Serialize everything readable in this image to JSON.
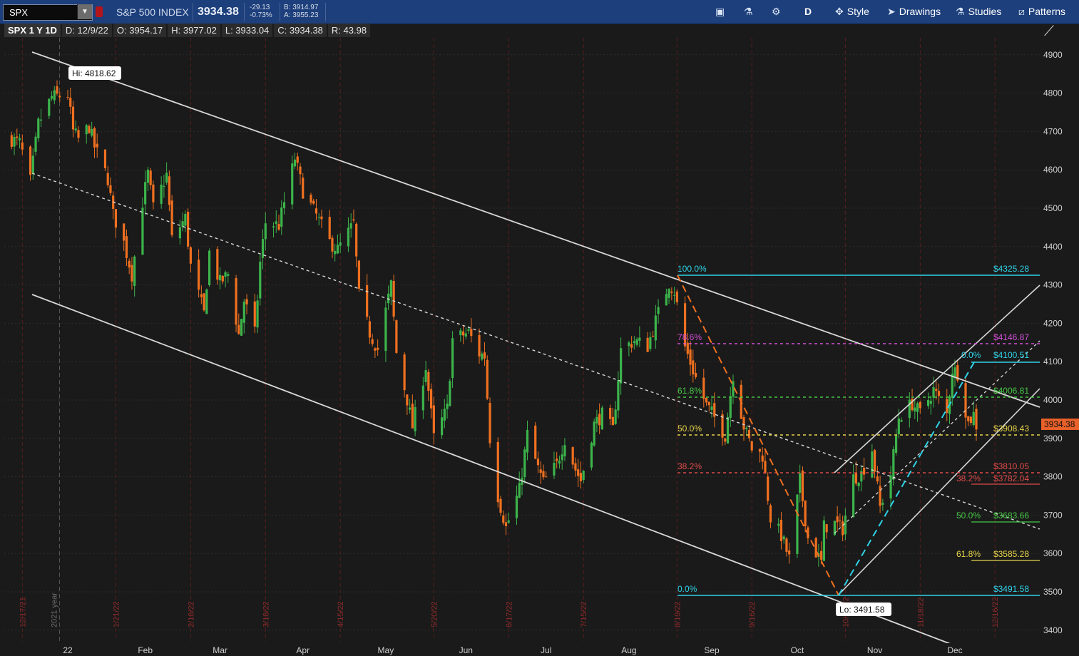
{
  "header": {
    "symbol": "SPX",
    "index_name": "S&P 500 INDEX",
    "last": "3934.38",
    "net_change": "-29.13",
    "pct_change": "-0.73%",
    "bid": "B: 3914.97",
    "ask": "A: 3955.23",
    "toolbar": {
      "aggregation": "D",
      "style": "Style",
      "drawings": "Drawings",
      "studies": "Studies",
      "patterns": "Patterns"
    }
  },
  "info": {
    "symbol": "SPX 1 Y 1D",
    "date": "D: 12/9/22",
    "open": "O: 3954.17",
    "high": "H: 3977.02",
    "low": "L: 3933.04",
    "close": "C: 3934.38",
    "range": "R: 43.98"
  },
  "colors": {
    "up": "#3cb44b",
    "down": "#f07020",
    "background": "#1a1a1a",
    "topbar": "#1d3f7c",
    "price_tag": "#e8602a",
    "fib_cyan": "#2fd3e8",
    "fib_magenta": "#d24fd8",
    "fib_green": "#46c846",
    "fib_yellow": "#e8d44a",
    "fib_red": "#e04a4a",
    "channel": "#d8d8d8"
  },
  "chart_data": {
    "type": "candlestick",
    "symbol": "SPX",
    "period": "1 Y",
    "interval": "1D",
    "ylim": [
      3370,
      4960
    ],
    "yticks": [
      3400,
      3500,
      3600,
      3700,
      3800,
      3900,
      4000,
      4100,
      4200,
      4300,
      4400,
      4500,
      4600,
      4700,
      4800,
      4900
    ],
    "month_labels": [
      {
        "label": "22",
        "date": "2022-01-03"
      },
      {
        "label": "Feb",
        "date": "2022-02-01"
      },
      {
        "label": "Mar",
        "date": "2022-03-01"
      },
      {
        "label": "Apr",
        "date": "2022-04-01"
      },
      {
        "label": "May",
        "date": "2022-05-02"
      },
      {
        "label": "Jun",
        "date": "2022-06-01"
      },
      {
        "label": "Jul",
        "date": "2022-07-01"
      },
      {
        "label": "Aug",
        "date": "2022-08-01"
      },
      {
        "label": "Sep",
        "date": "2022-09-01"
      },
      {
        "label": "Oct",
        "date": "2022-10-03"
      },
      {
        "label": "Nov",
        "date": "2022-11-01"
      },
      {
        "label": "Dec",
        "date": "2022-12-01"
      }
    ],
    "expiration_markers": [
      "12/17/21",
      "1/21/22",
      "2/18/22",
      "3/18/22",
      "4/15/22",
      "5/20/22",
      "6/17/22",
      "7/15/22",
      "8/19/22",
      "9/16/22",
      "10/21/22",
      "11/18/22",
      "12/16/22"
    ],
    "year_marker": "2021 year",
    "last_price": 3934.38,
    "high_annotation": {
      "label": "Hi: 4818.62",
      "value": 4818.62
    },
    "low_annotation": {
      "label": "Lo: 3491.58",
      "value": 3491.58
    },
    "fib_retracement_1": [
      {
        "pct": "100.0%",
        "value": "$4325.28"
      },
      {
        "pct": "78.6%",
        "value": "$4146.87"
      },
      {
        "pct": "61.8%",
        "value": "$4006.81"
      },
      {
        "pct": "50.0%",
        "value": "$3908.43"
      },
      {
        "pct": "38.2%",
        "value": "$3810.05"
      },
      {
        "pct": "0.0%",
        "value": "$3491.58"
      }
    ],
    "fib_retracement_2": [
      {
        "pct": "0.0%",
        "value": "$4100.51"
      },
      {
        "pct": "38.2%",
        "value": "$3782.04"
      },
      {
        "pct": "50.0%",
        "value": "$3683.66"
      },
      {
        "pct": "61.8%",
        "value": "$3585.28"
      }
    ],
    "close_path": [
      [
        "2021-12-13",
        4680
      ],
      [
        "2021-12-16",
        4670
      ],
      [
        "2021-12-20",
        4570
      ],
      [
        "2021-12-23",
        4720
      ],
      [
        "2021-12-28",
        4790
      ],
      [
        "2022-01-03",
        4796
      ],
      [
        "2022-01-05",
        4700
      ],
      [
        "2022-01-07",
        4680
      ],
      [
        "2022-01-11",
        4713
      ],
      [
        "2022-01-13",
        4660
      ],
      [
        "2022-01-18",
        4577
      ],
      [
        "2022-01-20",
        4483
      ],
      [
        "2022-01-24",
        4410
      ],
      [
        "2022-01-27",
        4327
      ],
      [
        "2022-01-31",
        4516
      ],
      [
        "2022-02-02",
        4590
      ],
      [
        "2022-02-04",
        4500
      ],
      [
        "2022-02-09",
        4587
      ],
      [
        "2022-02-11",
        4419
      ],
      [
        "2022-02-16",
        4475
      ],
      [
        "2022-02-18",
        4349
      ],
      [
        "2022-02-23",
        4225
      ],
      [
        "2022-02-25",
        4385
      ],
      [
        "2022-03-01",
        4306
      ],
      [
        "2022-03-04",
        4328
      ],
      [
        "2022-03-08",
        4170
      ],
      [
        "2022-03-10",
        4260
      ],
      [
        "2022-03-14",
        4173
      ],
      [
        "2022-03-16",
        4358
      ],
      [
        "2022-03-18",
        4463
      ],
      [
        "2022-03-23",
        4456
      ],
      [
        "2022-03-29",
        4631
      ],
      [
        "2022-04-01",
        4545
      ],
      [
        "2022-04-06",
        4481
      ],
      [
        "2022-04-11",
        4412
      ],
      [
        "2022-04-14",
        4392
      ],
      [
        "2022-04-20",
        4459
      ],
      [
        "2022-04-22",
        4272
      ],
      [
        "2022-04-26",
        4175
      ],
      [
        "2022-04-29",
        4132
      ],
      [
        "2022-05-04",
        4300
      ],
      [
        "2022-05-06",
        4123
      ],
      [
        "2022-05-10",
        4001
      ],
      [
        "2022-05-12",
        3930
      ],
      [
        "2022-05-17",
        4088
      ],
      [
        "2022-05-20",
        3901
      ],
      [
        "2022-05-25",
        3978
      ],
      [
        "2022-05-27",
        4158
      ],
      [
        "2022-06-02",
        4176
      ],
      [
        "2022-06-06",
        4121
      ],
      [
        "2022-06-08",
        4115
      ],
      [
        "2022-06-10",
        3901
      ],
      [
        "2022-06-13",
        3750
      ],
      [
        "2022-06-16",
        3667
      ],
      [
        "2022-06-21",
        3765
      ],
      [
        "2022-06-24",
        3911
      ],
      [
        "2022-06-28",
        3821
      ],
      [
        "2022-06-30",
        3785
      ],
      [
        "2022-07-05",
        3831
      ],
      [
        "2022-07-08",
        3899
      ],
      [
        "2022-07-12",
        3819
      ],
      [
        "2022-07-14",
        3790
      ],
      [
        "2022-07-19",
        3937
      ],
      [
        "2022-07-22",
        3962
      ],
      [
        "2022-07-26",
        3921
      ],
      [
        "2022-07-29",
        4130
      ],
      [
        "2022-08-03",
        4155
      ],
      [
        "2022-08-08",
        4140
      ],
      [
        "2022-08-11",
        4207
      ],
      [
        "2022-08-16",
        4305
      ],
      [
        "2022-08-18",
        4284
      ],
      [
        "2022-08-22",
        4138
      ],
      [
        "2022-08-26",
        4057
      ],
      [
        "2022-08-30",
        3986
      ],
      [
        "2022-09-01",
        3966
      ],
      [
        "2022-09-06",
        3908
      ],
      [
        "2022-09-09",
        4067
      ],
      [
        "2022-09-13",
        3932
      ],
      [
        "2022-09-16",
        3873
      ],
      [
        "2022-09-20",
        3856
      ],
      [
        "2022-09-23",
        3693
      ],
      [
        "2022-09-27",
        3647
      ],
      [
        "2022-09-30",
        3586
      ],
      [
        "2022-10-04",
        3791
      ],
      [
        "2022-10-07",
        3640
      ],
      [
        "2022-10-12",
        3577
      ],
      [
        "2022-10-13",
        3670
      ],
      [
        "2022-10-17",
        3678
      ],
      [
        "2022-10-20",
        3665
      ],
      [
        "2022-10-24",
        3797
      ],
      [
        "2022-10-27",
        3808
      ],
      [
        "2022-10-31",
        3872
      ],
      [
        "2022-11-03",
        3720
      ],
      [
        "2022-11-07",
        3807
      ],
      [
        "2022-11-10",
        3956
      ],
      [
        "2022-11-15",
        3991
      ],
      [
        "2022-11-18",
        3965
      ],
      [
        "2022-11-23",
        4027
      ],
      [
        "2022-11-28",
        3963
      ],
      [
        "2022-11-30",
        4080
      ],
      [
        "2022-12-02",
        4071
      ],
      [
        "2022-12-06",
        3941
      ],
      [
        "2022-12-08",
        3963
      ],
      [
        "2022-12-09",
        3934
      ]
    ]
  }
}
